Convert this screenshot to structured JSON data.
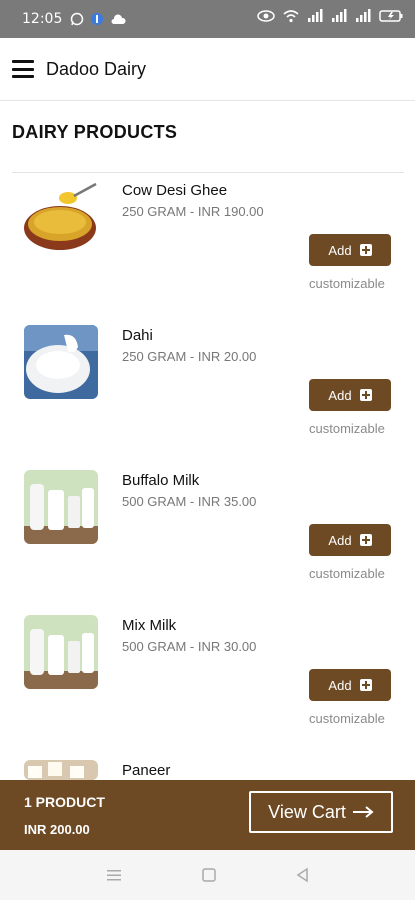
{
  "status": {
    "time": "12:05"
  },
  "app": {
    "title": "Dadoo Dairy"
  },
  "section": {
    "title": "DAIRY PRODUCTS"
  },
  "products": [
    {
      "name": "Cow Desi Ghee",
      "meta": "250 GRAM - INR 190.00",
      "add_label": "Add",
      "note": "customizable",
      "image": "ghee-bowl"
    },
    {
      "name": "Dahi",
      "meta": "250 GRAM - INR 20.00",
      "add_label": "Add",
      "note": "customizable",
      "image": "curd-bowl"
    },
    {
      "name": "Buffalo Milk",
      "meta": "500 GRAM - INR 35.00",
      "add_label": "Add",
      "note": "customizable",
      "image": "milk-bottles"
    },
    {
      "name": "Mix Milk",
      "meta": "500 GRAM - INR 30.00",
      "add_label": "Add",
      "note": "customizable",
      "image": "milk-bottles"
    },
    {
      "name": "Paneer",
      "meta": "",
      "add_label": "",
      "note": "",
      "image": "paneer-cubes"
    }
  ],
  "cart": {
    "count": "1 PRODUCT",
    "total": "INR 200.00",
    "button_label": "View Cart"
  },
  "colors": {
    "brand": "#6e4a24",
    "statusbar": "#7a7a7a"
  }
}
